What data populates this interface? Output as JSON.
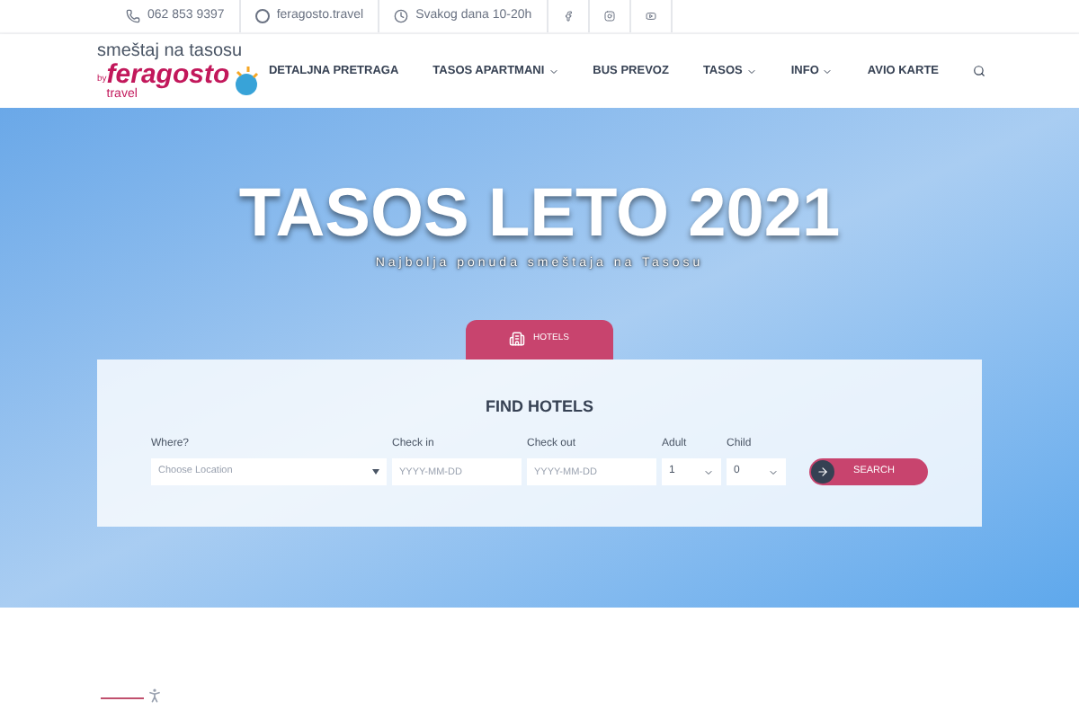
{
  "topbar": {
    "phone": "062 853 9397",
    "skype": "feragosto.travel",
    "hours": "Svakog dana 10-20h"
  },
  "logo": {
    "tagline": "smeštaj na tasosu",
    "by": "by",
    "brand": "feragosto",
    "sub": "travel"
  },
  "nav": [
    {
      "label": "DETALJNA PRETRAGA",
      "dropdown": false
    },
    {
      "label": "TASOS APARTMANI",
      "dropdown": true
    },
    {
      "label": "BUS PREVOZ",
      "dropdown": false
    },
    {
      "label": "TASOS",
      "dropdown": true
    },
    {
      "label": "INFO",
      "dropdown": true
    },
    {
      "label": "AVIO KARTE",
      "dropdown": false
    }
  ],
  "hero": {
    "title": "TASOS LETO 2021",
    "subtitle": "Najbolja ponuda smeštaja na Tasosu"
  },
  "tabs": [
    {
      "label": "HOTELS",
      "selected": true
    }
  ],
  "search": {
    "title": "FIND HOTELS",
    "fields": [
      {
        "kind": "select",
        "label": "Where?",
        "placeholder": "Choose Location"
      },
      {
        "kind": "date",
        "label": "Check in",
        "placeholder": "YYYY-MM-DD"
      },
      {
        "kind": "date",
        "label": "Check out",
        "placeholder": "YYYY-MM-DD"
      },
      {
        "kind": "number",
        "label": "Adult",
        "value": "1"
      },
      {
        "kind": "number",
        "label": "Child",
        "value": "0"
      }
    ],
    "button": "SEARCH"
  }
}
